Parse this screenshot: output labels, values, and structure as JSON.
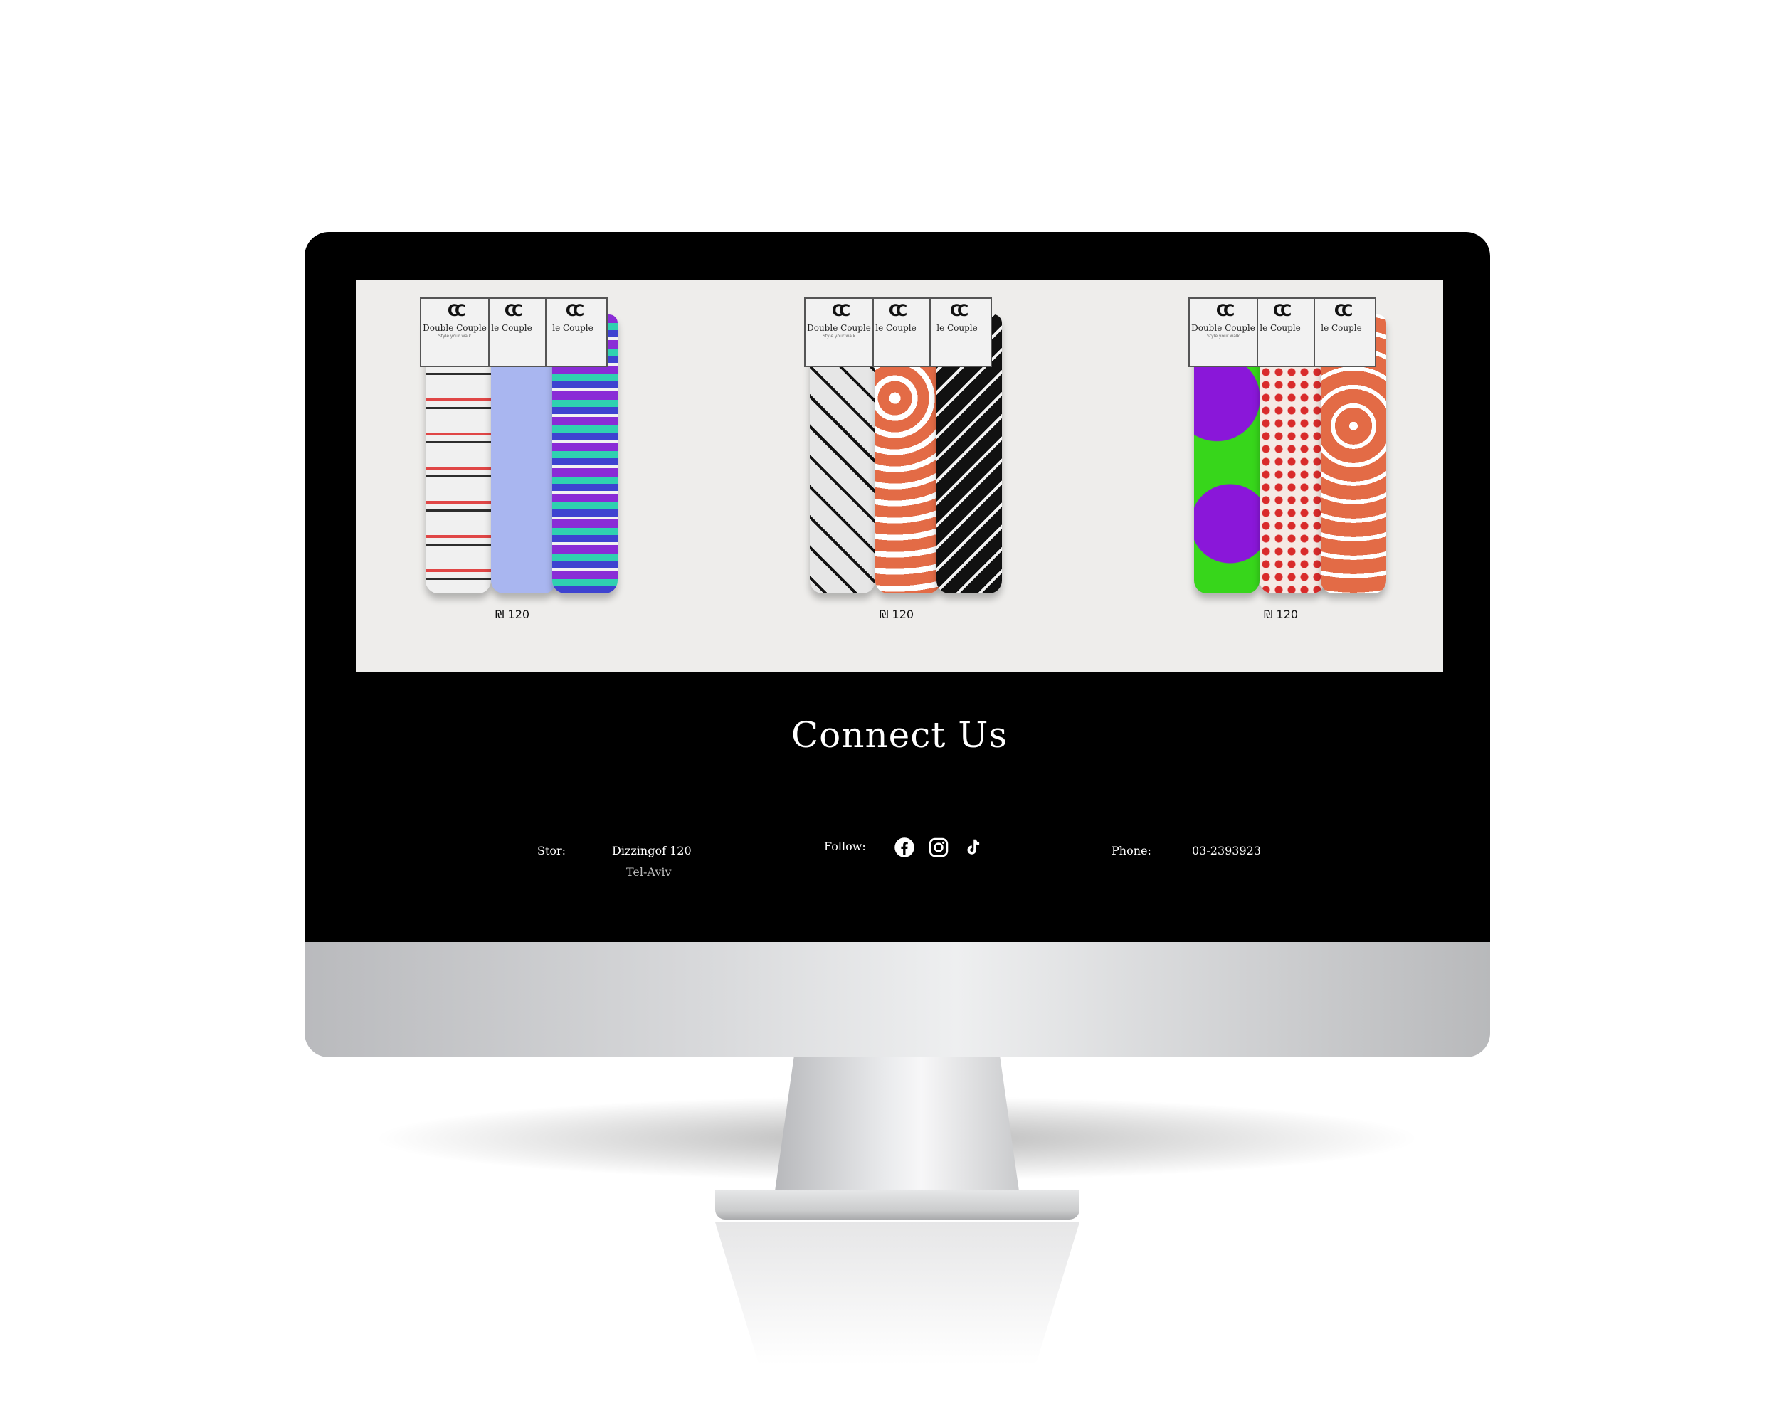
{
  "products": [
    {
      "price_symbol": "₪",
      "price": "120",
      "card": {
        "logo": "CC",
        "brand": "Double Couple",
        "tag": "Style your walk"
      },
      "partial_brand": "le Couple"
    },
    {
      "price_symbol": "₪",
      "price": "120",
      "card": {
        "logo": "CC",
        "brand": "Double Couple",
        "tag": "Style your walk"
      },
      "partial_brand": "le Couple"
    },
    {
      "price_symbol": "₪",
      "price": "120",
      "card": {
        "logo": "CC",
        "brand": "Double Couple",
        "tag": "Style your walk"
      },
      "partial_brand": "le Couple"
    }
  ],
  "footer": {
    "title": "Connect Us",
    "store_label": "Stor:",
    "store_address": "Dizzingof 120",
    "store_city": "Tel-Aviv",
    "follow_label": "Follow:",
    "social": [
      "facebook-icon",
      "instagram-icon",
      "tiktok-icon"
    ],
    "phone_label": "Phone:",
    "phone_value": "03-2393923"
  },
  "colors": {
    "bezel": "#000000",
    "products_bg": "#eeedeb",
    "footer_bg": "#000000",
    "footer_text": "#ffffff"
  }
}
